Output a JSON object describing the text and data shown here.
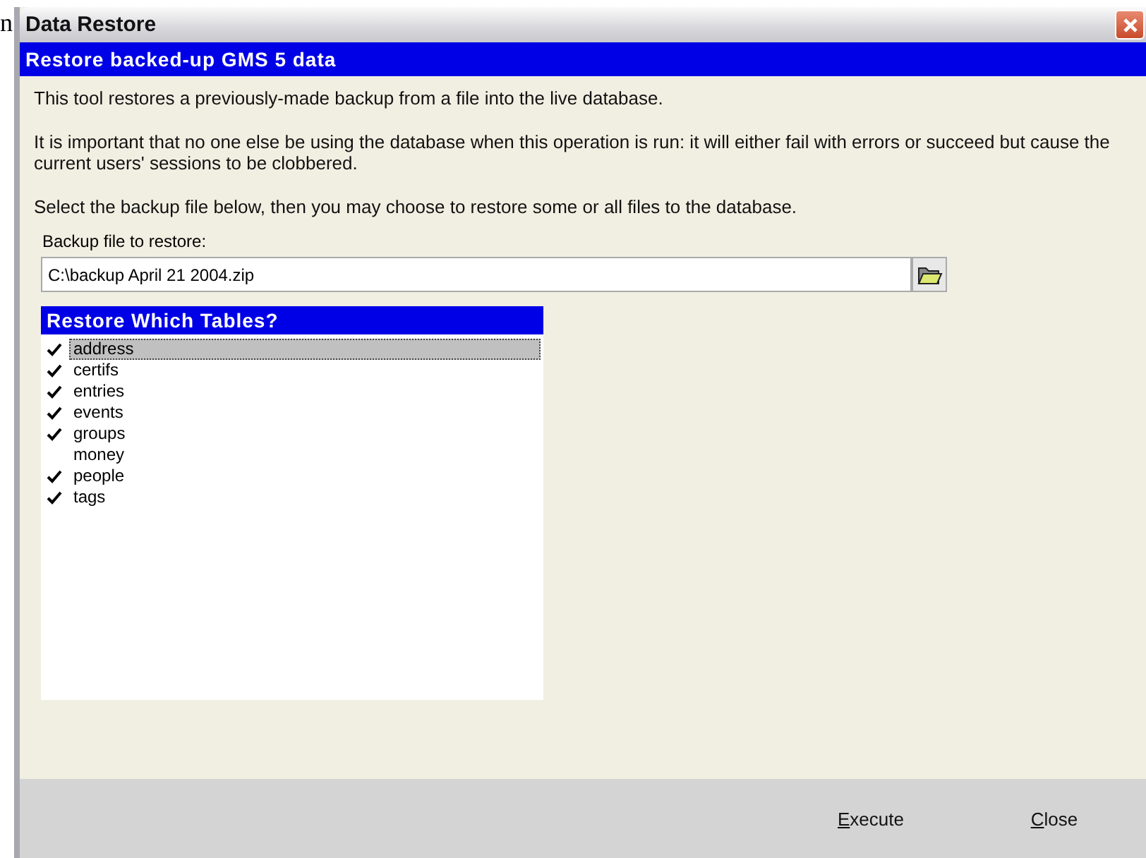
{
  "background_fragment": "n",
  "window": {
    "title": "Data Restore"
  },
  "header": "Restore backed-up GMS 5 data",
  "paragraphs": [
    "This tool restores a previously-made backup from a file into the live database.",
    "It is important that no one else be using the database when this operation is run: it will either fail with errors or succeed but cause the current users' sessions to be clobbered.",
    "Select the backup file below, then you may choose to restore some or all files to the database."
  ],
  "backup_file": {
    "label": "Backup file to restore:",
    "value": "C:\\backup April 21 2004.zip"
  },
  "tables": {
    "title": "Restore Which Tables?",
    "items": [
      {
        "name": "address",
        "checked": true,
        "selected": true
      },
      {
        "name": "certifs",
        "checked": true,
        "selected": false
      },
      {
        "name": "entries",
        "checked": true,
        "selected": false
      },
      {
        "name": "events",
        "checked": true,
        "selected": false
      },
      {
        "name": "groups",
        "checked": true,
        "selected": false
      },
      {
        "name": "money",
        "checked": false,
        "selected": false
      },
      {
        "name": "people",
        "checked": true,
        "selected": false
      },
      {
        "name": "tags",
        "checked": true,
        "selected": false
      }
    ]
  },
  "buttons": [
    {
      "label": "Execute",
      "underline_first": true
    },
    {
      "label": "Close",
      "underline_first": true
    }
  ]
}
